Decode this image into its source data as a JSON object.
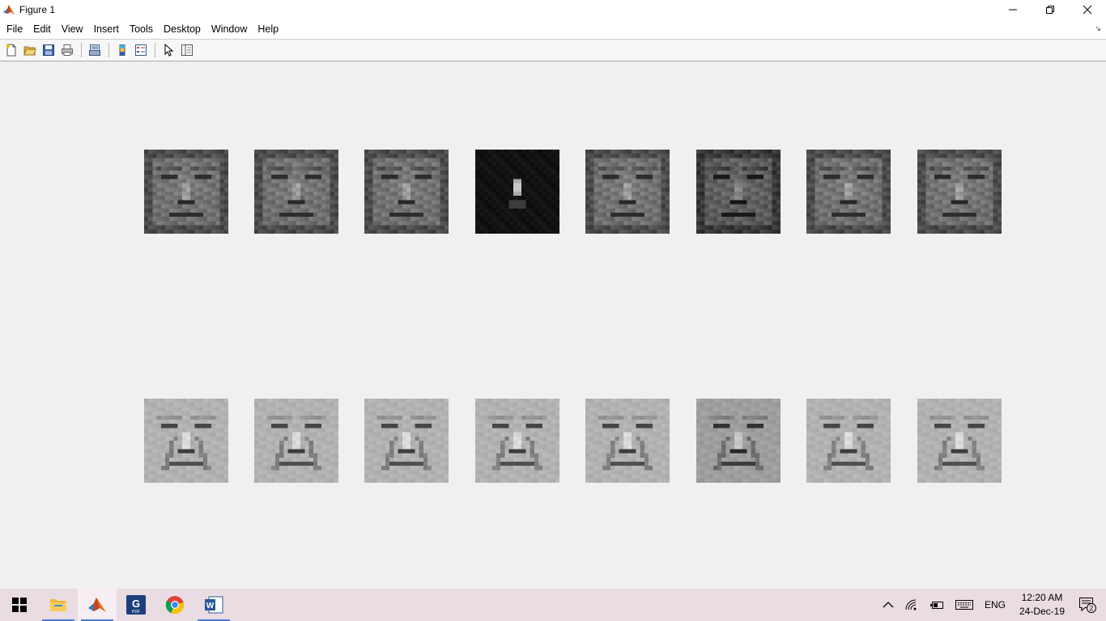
{
  "window": {
    "title": "Figure 1",
    "controls": {
      "minimize": "—",
      "restore": "❐",
      "close": "✕"
    }
  },
  "menu": {
    "items": [
      "File",
      "Edit",
      "View",
      "Insert",
      "Tools",
      "Desktop",
      "Window",
      "Help"
    ]
  },
  "toolbar": {
    "buttons": [
      "new-figure",
      "open-file",
      "save-figure",
      "print-figure",
      "print-preview",
      "insert-colorbar",
      "insert-legend",
      "edit-plot",
      "show-plot-tools"
    ]
  },
  "faces": {
    "top_row": [
      "face-1",
      "face-2",
      "face-3",
      "face-4-dark",
      "face-5",
      "face-6",
      "face-7",
      "face-8"
    ],
    "bottom_row": [
      "eigenface-1",
      "eigenface-2",
      "eigenface-3",
      "eigenface-4",
      "eigenface-5",
      "eigenface-6",
      "eigenface-7",
      "eigenface-8"
    ]
  },
  "taskbar": {
    "apps": [
      "start",
      "file-explorer",
      "matlab",
      "foxit-pdf",
      "chrome",
      "word"
    ],
    "tray": {
      "language": "ENG",
      "time": "12:20 AM",
      "date": "24-Dec-19",
      "notification_count": "2"
    }
  },
  "colors": {
    "taskbar": "#eadce3",
    "figure_bg": "#f0f0f0",
    "accent": "#4a7fd4"
  }
}
